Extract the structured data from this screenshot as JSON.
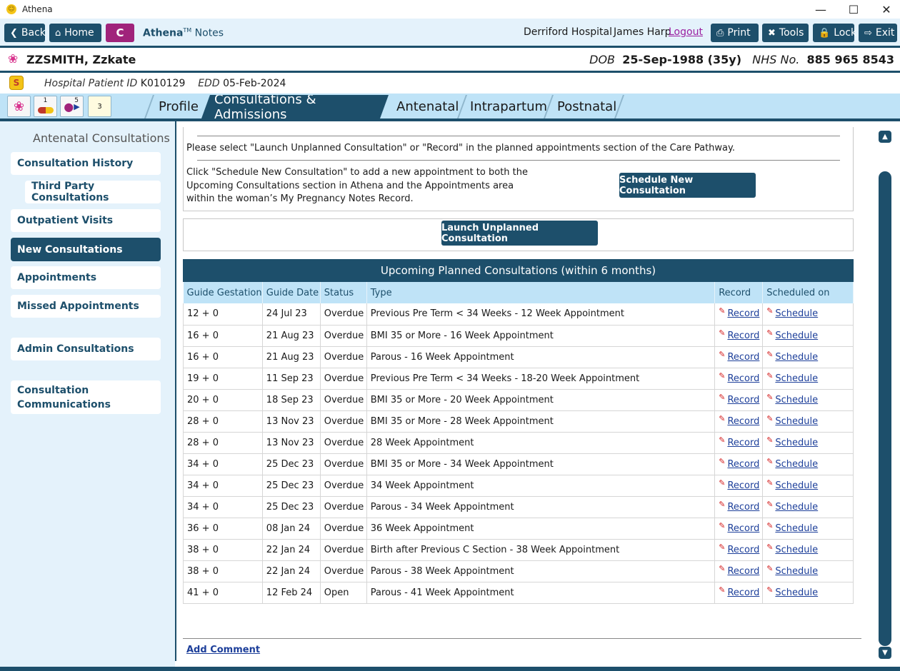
{
  "window": {
    "title": "Athena"
  },
  "toolbar": {
    "back": "Back",
    "home": "Home",
    "c_label": "C",
    "brand": "Athena",
    "tm": "TM",
    "notes": "Notes",
    "hospital": "Derriford Hospital",
    "user": "James Harp",
    "logout": "Logout",
    "print": "Print",
    "tools": "Tools",
    "lock": "Lock",
    "exit": "Exit"
  },
  "patient": {
    "name": "ZZSMITH, Zzkate",
    "dob_label": "DOB",
    "dob": "25-Sep-1988 (35y)",
    "nhs_label": "NHS No.",
    "nhs": "885 965 8543",
    "hpid_label": "Hospital Patient ID",
    "hpid": "K010129",
    "edd_label": "EDD",
    "edd": "05-Feb-2024"
  },
  "quick_icons": [
    "1",
    "5",
    "3"
  ],
  "tabs": [
    "Profile",
    "Consultations & Admissions",
    "Antenatal",
    "Intrapartum",
    "Postnatal"
  ],
  "nav": {
    "title": "Antenatal Consultations",
    "items": [
      "Consultation History",
      "Third Party Consultations",
      "Outpatient Visits",
      "New Consultations",
      "Appointments",
      "Missed Appointments",
      "Admin Consultations",
      "Consultation Communications"
    ]
  },
  "main": {
    "instruction1": "Please select \"Launch Unplanned Consultation\" or \"Record\" in the planned appointments section of the Care Pathway.",
    "instruction2_l1": "Click \"Schedule New Consultation\" to add a new appointment to both the",
    "instruction2_l2": "Upcoming Consultations section in Athena and the Appointments area",
    "instruction2_l3": "within the woman’s My Pregnancy Notes Record.",
    "schedule_btn": "Schedule New Consultation",
    "launch_btn": "Launch Unplanned Consultation",
    "table_title": "Upcoming Planned Consultations (within 6 months)",
    "columns": [
      "Guide Gestation",
      "Guide Date",
      "Status",
      "Type",
      "Record",
      "Scheduled on"
    ],
    "rows": [
      [
        "12 + 0",
        "24 Jul 23",
        "Overdue",
        "Previous Pre Term < 34 Weeks - 12 Week Appointment"
      ],
      [
        "16 + 0",
        "21 Aug 23",
        "Overdue",
        "BMI 35 or More - 16 Week Appointment"
      ],
      [
        "16 + 0",
        "21 Aug 23",
        "Overdue",
        "Parous - 16 Week Appointment"
      ],
      [
        "19 + 0",
        "11 Sep 23",
        "Overdue",
        "Previous Pre Term < 34 Weeks - 18-20 Week Appointment"
      ],
      [
        "20 + 0",
        "18 Sep 23",
        "Overdue",
        "BMI 35 or More - 20 Week Appointment"
      ],
      [
        "28 + 0",
        "13 Nov 23",
        "Overdue",
        "BMI 35 or More - 28 Week Appointment"
      ],
      [
        "28 + 0",
        "13 Nov 23",
        "Overdue",
        "28 Week Appointment"
      ],
      [
        "34 + 0",
        "25 Dec 23",
        "Overdue",
        "BMI 35 or More - 34 Week Appointment"
      ],
      [
        "34 + 0",
        "25 Dec 23",
        "Overdue",
        "34 Week Appointment"
      ],
      [
        "34 + 0",
        "25 Dec 23",
        "Overdue",
        "Parous - 34 Week Appointment"
      ],
      [
        "36 + 0",
        "08 Jan 24",
        "Overdue",
        "36 Week Appointment"
      ],
      [
        "38 + 0",
        "22 Jan 24",
        "Overdue",
        "Birth after Previous C Section - 38 Week Appointment"
      ],
      [
        "38 + 0",
        "22 Jan 24",
        "Overdue",
        "Parous - 38 Week Appointment"
      ],
      [
        "41 + 0",
        "12 Feb 24",
        "Open",
        "Parous - 41 Week Appointment"
      ]
    ],
    "record_link": "Record",
    "schedule_link": "Schedule",
    "add_comment": "Add Comment"
  },
  "colors": {
    "primary": "#1d4f6b",
    "light": "#bfe3f7",
    "panel": "#e4f2fb",
    "accent": "#a0237b"
  }
}
